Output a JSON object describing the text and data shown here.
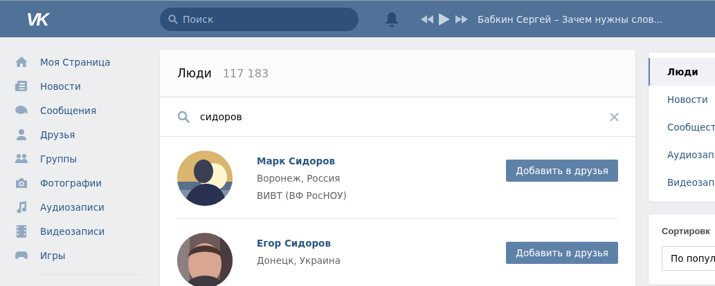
{
  "header": {
    "logo": "VK",
    "search": {
      "placeholder": "Поиск"
    },
    "player": {
      "track": "Бабкин Сергей – Зачем нужны слов..."
    }
  },
  "sidebar": {
    "items": [
      {
        "label": "Моя Страница"
      },
      {
        "label": "Новости"
      },
      {
        "label": "Сообщения"
      },
      {
        "label": "Друзья"
      },
      {
        "label": "Группы"
      },
      {
        "label": "Фотографии"
      },
      {
        "label": "Аудиозаписи"
      },
      {
        "label": "Видеозаписи"
      },
      {
        "label": "Игры"
      }
    ]
  },
  "results": {
    "title": "Люди",
    "count": "117 183",
    "search": {
      "value": "сидоров"
    },
    "people": [
      {
        "name": "Марк Сидоров",
        "lines": [
          "Воронеж, Россия",
          "ВИВТ (ВФ РосНОУ)"
        ],
        "button": "Добавить в друзья",
        "photo": {
          "kind": "picture"
        }
      },
      {
        "name": "Егор Сидоров",
        "lines": [
          "Донецк, Украина"
        ],
        "button": "Добавить в друзья",
        "photo": {
          "kind": "picture"
        }
      }
    ]
  },
  "filters": {
    "tabs": [
      {
        "label": "Люди",
        "selected": true
      },
      {
        "label": "Новости",
        "selected": false
      },
      {
        "label": "Сообщест",
        "selected": false
      },
      {
        "label": "Аудиозап",
        "selected": false
      },
      {
        "label": "Видеозап",
        "selected": false
      }
    ],
    "sort": {
      "title": "Сортировк",
      "value": "По попул"
    }
  }
}
